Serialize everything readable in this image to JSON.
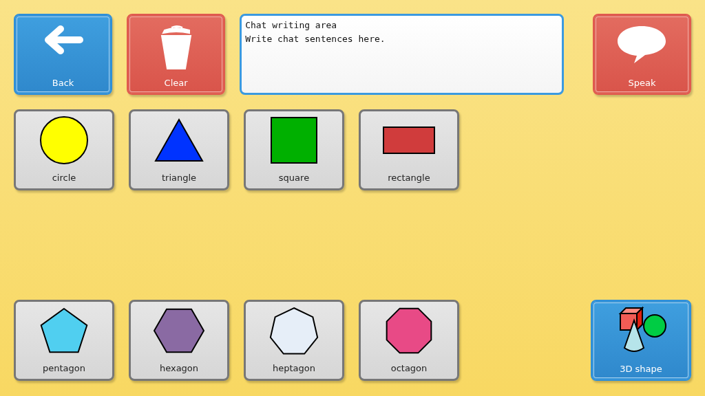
{
  "top_bar": [
    {
      "kind": "back",
      "label": "Back"
    },
    {
      "kind": "clear",
      "label": "Clear"
    },
    {
      "kind": "chat",
      "lines": [
        "Chat writing area",
        "Write chat sentences here."
      ]
    },
    {
      "kind": "speak",
      "label": "Speak"
    }
  ],
  "top_tiles": [
    {
      "kind": "circle",
      "label": "circle"
    },
    {
      "kind": "triangle",
      "label": "triangle"
    },
    {
      "kind": "square",
      "label": "square"
    },
    {
      "kind": "rectangle",
      "label": "rectangle"
    }
  ],
  "bottom_tiles": [
    {
      "kind": "pentagon",
      "label": "pentagon"
    },
    {
      "kind": "hexagon",
      "label": "hexagon"
    },
    {
      "kind": "heptagon",
      "label": "heptagon"
    },
    {
      "kind": "octagon",
      "label": "octagon"
    }
  ],
  "corner_button": {
    "kind": "shapes3d",
    "label": "3D shape"
  }
}
